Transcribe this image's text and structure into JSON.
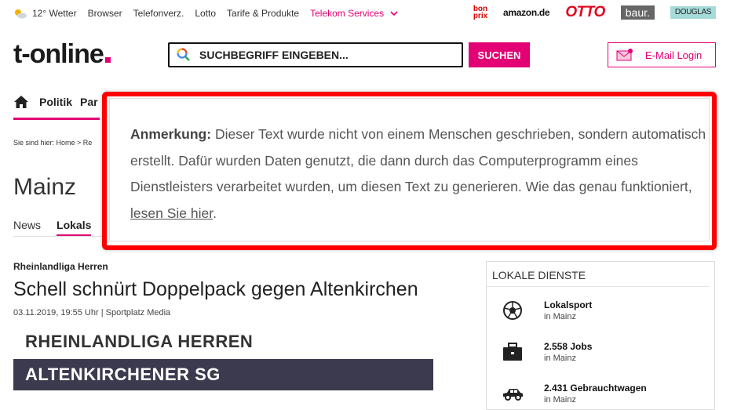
{
  "topbar": {
    "weather": "12° Wetter",
    "links": [
      "Browser",
      "Telefonverz.",
      "Lotto",
      "Tarife & Produkte"
    ],
    "telekom_services": "Telekom Services",
    "partners": {
      "bonprix": "bon prix",
      "amazon": "amazon.de",
      "otto": "OTTO",
      "baur": "baur.",
      "douglas": "DOUGLAS"
    }
  },
  "header": {
    "logo": "t-online",
    "search_placeholder": "SUCHBEGRIFF EINGEBEN...",
    "search_button": "SUCHEN",
    "email_login": "E-Mail Login"
  },
  "nav": {
    "items": [
      "Politik",
      "Par"
    ]
  },
  "breadcrumb": "Sie sind hier: Home > Re",
  "page": {
    "city": "Mainz",
    "tabs": [
      "News",
      "Lokals"
    ]
  },
  "note": {
    "label": "Anmerkung:",
    "text": "Dieser Text wurde nicht von einem Menschen geschrieben, sondern automatisch erstellt. Dafür wurden Daten genutzt, die dann durch das Computerprogramm eines Dienstleisters verarbeitet wurden, um diesen Text zu generieren. Wie das genau funktioniert,",
    "link": "lesen Sie hier",
    "end": "."
  },
  "article": {
    "kicker": "Rheinlandliga Herren",
    "headline": "Schell schnürt Doppelpack gegen Altenkirchen",
    "meta": "03.11.2019, 19:55 Uhr | Sportplatz Media",
    "league": "RHEINLANDLIGA HERREN",
    "team": "ALTENKIRCHENER SG"
  },
  "services": {
    "title": "LOKALE DIENSTE",
    "items": [
      {
        "name": "Lokalsport",
        "loc": "in Mainz",
        "icon": "football-icon"
      },
      {
        "name": "2.558 Jobs",
        "loc": "in Mainz",
        "icon": "briefcase-icon"
      },
      {
        "name": "2.431 Gebrauchtwagen",
        "loc": "in Mainz",
        "icon": "car-icon"
      }
    ]
  },
  "colors": {
    "brand": "#e20074",
    "highlight": "#ff0000",
    "team_bar": "#3c3a4e"
  }
}
